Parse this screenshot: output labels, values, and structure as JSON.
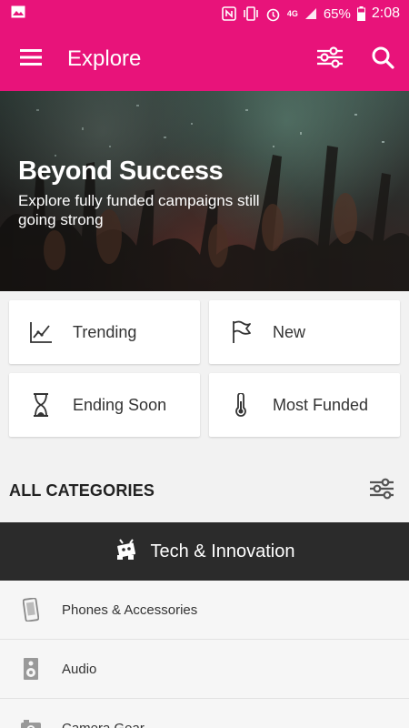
{
  "status": {
    "battery": "65%",
    "time": "2:08",
    "network": "4G"
  },
  "appbar": {
    "title": "Explore"
  },
  "hero": {
    "title": "Beyond Success",
    "subtitle": "Explore fully funded campaigns still going strong"
  },
  "tiles": [
    {
      "label": "Trending",
      "icon": "trending-icon"
    },
    {
      "label": "New",
      "icon": "flag-icon"
    },
    {
      "label": "Ending Soon",
      "icon": "hourglass-icon"
    },
    {
      "label": "Most Funded",
      "icon": "thermometer-icon"
    }
  ],
  "categories": {
    "header": "ALL CATEGORIES",
    "selected": "Tech & Innovation",
    "items": [
      {
        "label": "Phones & Accessories",
        "icon": "phone-icon"
      },
      {
        "label": "Audio",
        "icon": "speaker-icon"
      },
      {
        "label": "Camera Gear",
        "icon": "camera-icon"
      }
    ]
  },
  "colors": {
    "accent": "#e8137a",
    "dark": "#2b2b2b"
  }
}
